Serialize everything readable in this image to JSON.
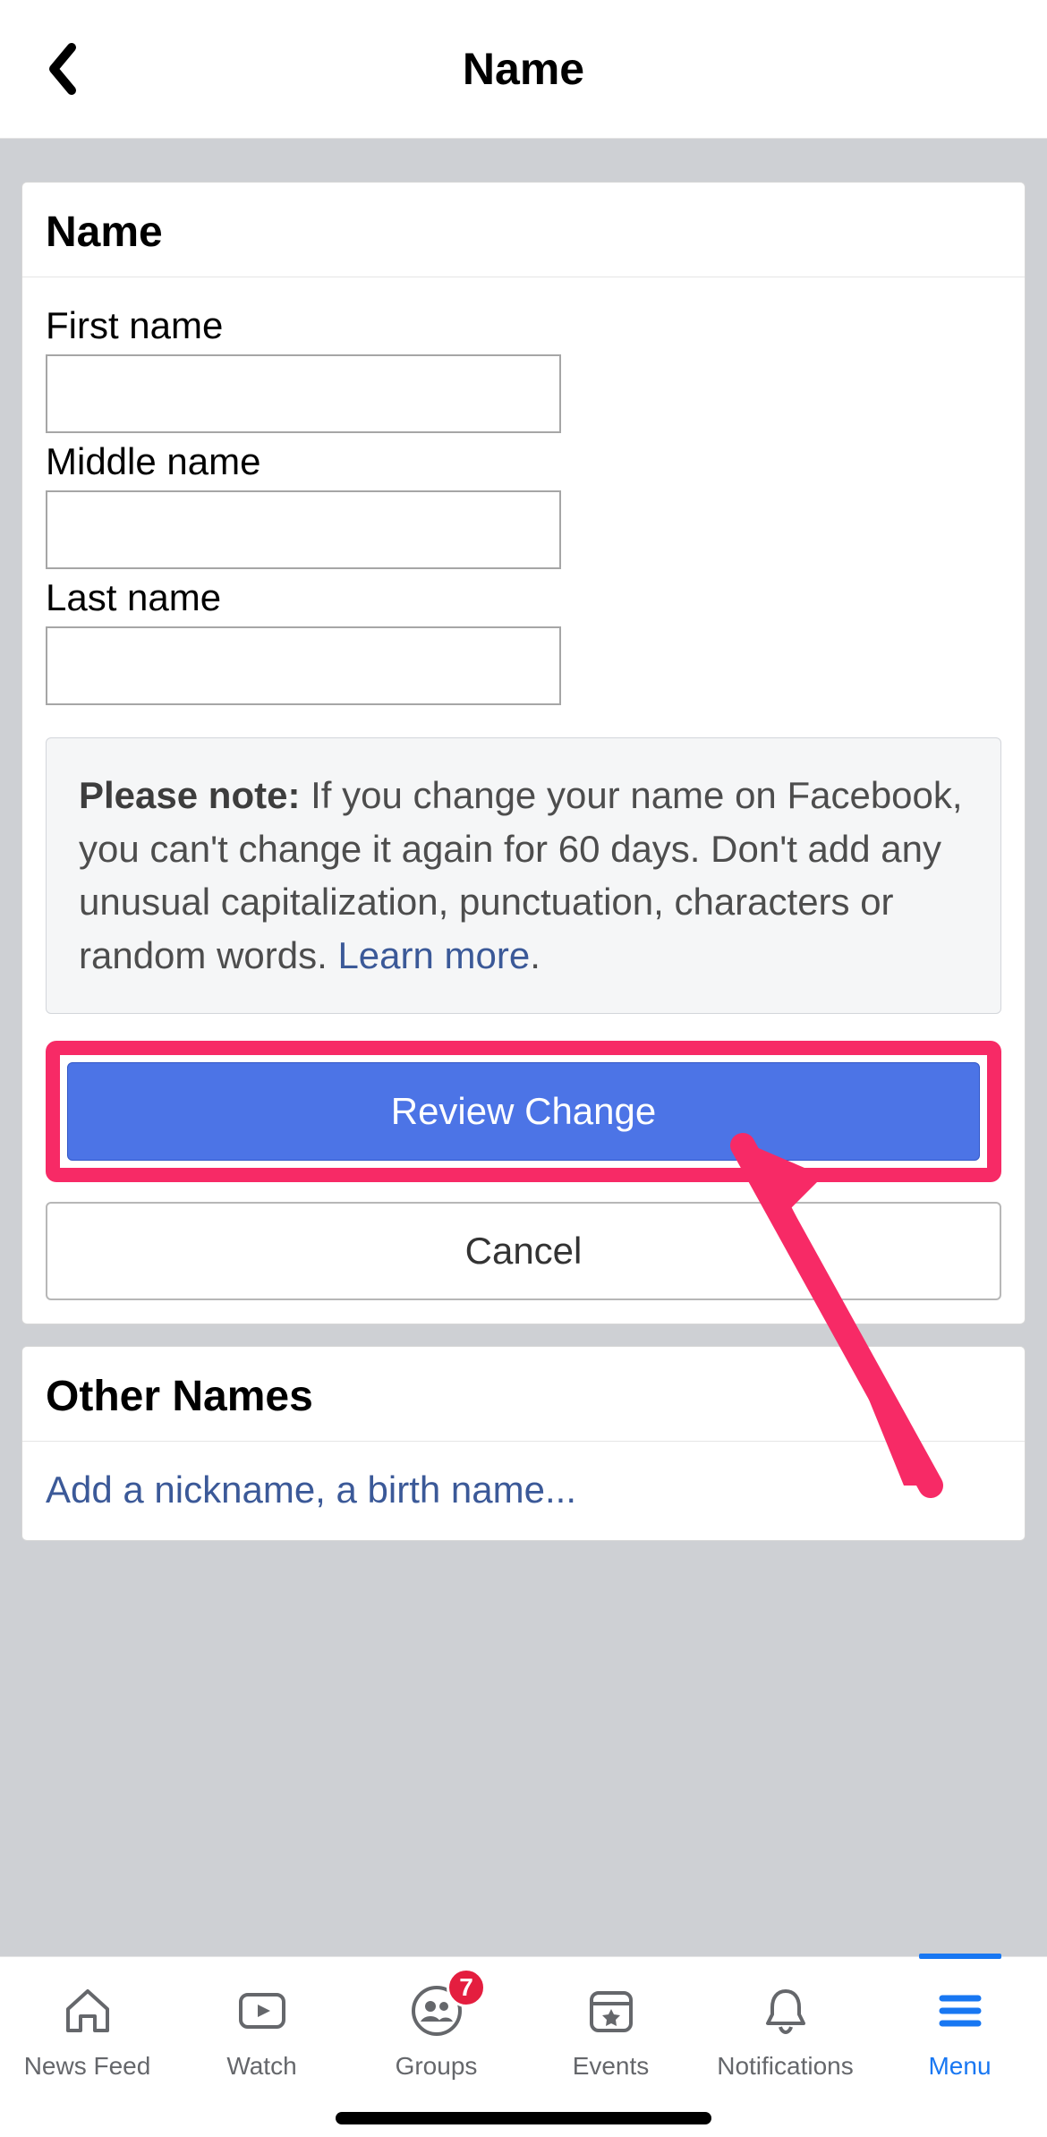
{
  "header": {
    "title": "Name"
  },
  "nameCard": {
    "title": "Name",
    "firstLabel": "First name",
    "firstValue": "",
    "middleLabel": "Middle name",
    "middleValue": "",
    "lastLabel": "Last name",
    "lastValue": "",
    "noticePrefix": "Please note:",
    "noticeBody": " If you change your name on Facebook, you can't change it again for 60 days. Don't add any unusual capitalization, punctuation, characters or random words. ",
    "learnMore": "Learn more",
    "noticeSuffix": ".",
    "reviewLabel": "Review Change",
    "cancelLabel": "Cancel"
  },
  "otherNamesCard": {
    "title": "Other Names",
    "addLink": "Add a nickname, a birth name..."
  },
  "tabs": {
    "feed": "News Feed",
    "watch": "Watch",
    "groups": "Groups",
    "groupsBadge": "7",
    "events": "Events",
    "notifications": "Notifications",
    "menu": "Menu"
  },
  "colors": {
    "accent": "#1877f2",
    "highlight": "#f72a66",
    "badge": "#e41e3f"
  }
}
